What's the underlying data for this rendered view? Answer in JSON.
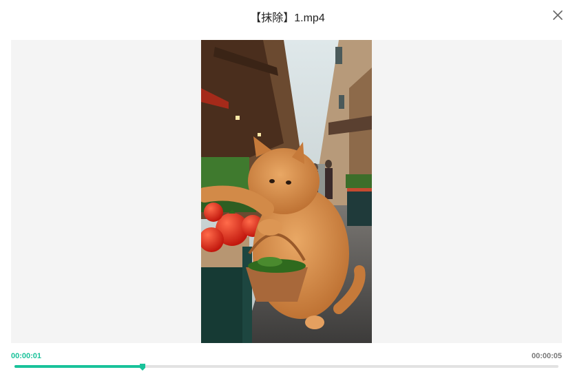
{
  "dialog": {
    "title": "【抹除】1.mp4"
  },
  "player": {
    "current_time": "00:00:01",
    "total_time": "00:00:05",
    "progress": 0.235,
    "accent_color": "#19c29a"
  },
  "icons": {
    "close": "close-icon",
    "scrubber": "scrubber-handle"
  },
  "video": {
    "description": "cat-vegetable-market"
  }
}
